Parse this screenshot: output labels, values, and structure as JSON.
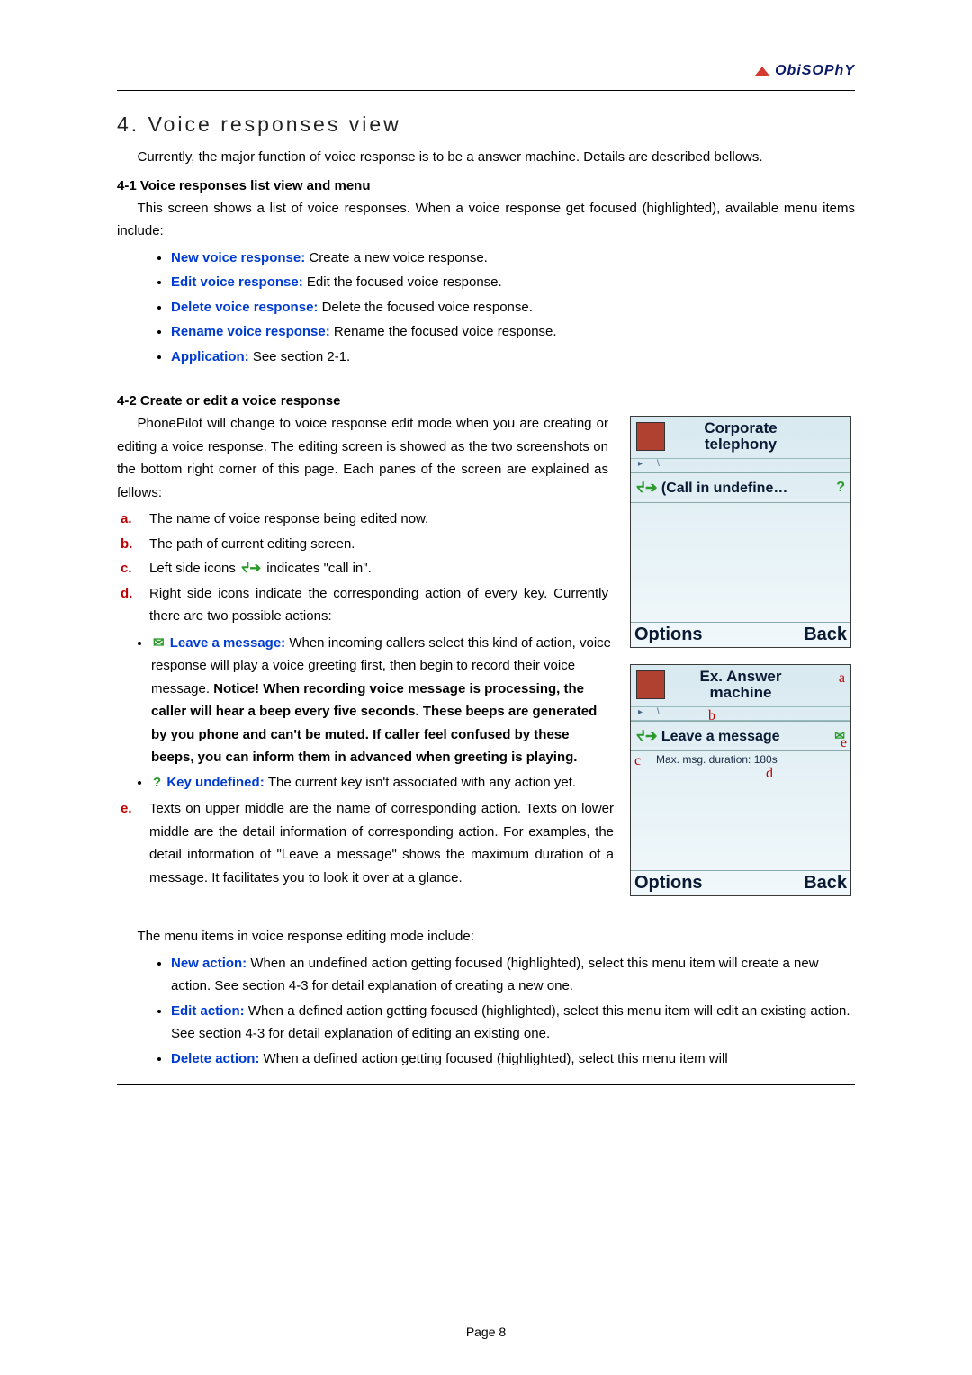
{
  "brand": "ObiSOPhY",
  "section_title": "4. Voice responses view",
  "intro": "Currently, the major function of voice response is to be a answer machine. Details are described bellows.",
  "sub41": {
    "heading": "4-1 Voice responses list view and menu",
    "para": "This screen shows a list of voice responses. When a voice response get focused (highlighted), available menu items include:",
    "items": [
      {
        "term": "New voice response: ",
        "desc": "Create a new voice response."
      },
      {
        "term": "Edit voice response: ",
        "desc": "Edit the focused voice response."
      },
      {
        "term": "Delete voice response: ",
        "desc": "Delete the focused voice response."
      },
      {
        "term": "Rename voice response: ",
        "desc": "Rename the focused voice response."
      },
      {
        "term": "Application: ",
        "desc": "See section 2-1."
      }
    ]
  },
  "sub42": {
    "heading": "4-2 Create or edit a voice response",
    "para": "PhonePilot will change to voice response edit mode when you are creating or editing a voice response. The editing screen is showed as the two screenshots on the bottom right corner of this page. Each panes of the screen are explained as fellows:",
    "letters": {
      "a": "The name of voice response being edited now.",
      "b": "The path of current editing screen.",
      "c_before": "Left side icons ",
      "c_after": " indicates \"call in\".",
      "d": "Right side icons indicate the corresponding action of every key. Currently there are two possible actions:"
    },
    "actions": {
      "leave_term": "Leave a message: ",
      "leave_desc": "When incoming callers select this kind of action, voice response will play a voice greeting first, then begin to record their voice message. ",
      "leave_bold": "Notice! When recording voice message is processing, the caller will hear a beep every five seconds. These beeps are generated by you phone and can't be muted. If caller feel confused by these beeps, you can inform them in advanced when greeting is playing.",
      "keyundef_term": "Key undefined: ",
      "keyundef_desc": "The current key isn't associated with any action yet."
    },
    "e_para": "Texts on upper middle are the name of corresponding action. Texts on lower middle are the detail information of corresponding action. For examples, the detail information of \"Leave a message\" shows the maximum duration of a message. It facilitates you to look it over at a glance.",
    "e_marker": "e.",
    "menu_intro": "The menu items in voice response editing mode include:",
    "menu": [
      {
        "term": "New action: ",
        "desc": "When an undefined action getting focused (highlighted), select this menu item will create a new action. See section 4-3 for detail explanation of creating a new one."
      },
      {
        "term": "Edit action: ",
        "desc": "When a defined action getting focused (highlighted), select this menu item will edit an existing action. See section 4-3 for detail explanation of editing an existing one."
      },
      {
        "term": "Delete action: ",
        "desc": "When a defined action getting focused (highlighted), select this menu item will"
      }
    ]
  },
  "screenshots": {
    "s1": {
      "title_l1": "Corporate",
      "title_l2": "telephony",
      "row": "(Call in undefine…",
      "opt": "Options",
      "back": "Back"
    },
    "s2": {
      "title_l1": "Ex. Answer",
      "title_l2": "machine",
      "row": "Leave a message",
      "sub": "Max. msg. duration: 180s",
      "opt": "Options",
      "back": "Back",
      "a": "a",
      "b": "b",
      "c": "c",
      "d": "d",
      "e": "e"
    }
  },
  "icons": {
    "callin": "ᔪ➔",
    "leave_msg": "✉",
    "question": "?"
  },
  "page_label": "Page 8"
}
